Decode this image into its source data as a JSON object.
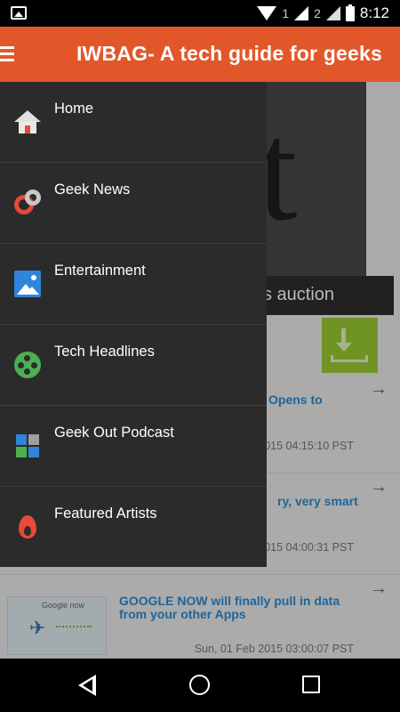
{
  "status_bar": {
    "time": "8:12",
    "sim1": "1",
    "sim2": "2",
    "icons": [
      "image-icon",
      "wifi-icon",
      "signal-icon",
      "signal-icon",
      "battery-icon"
    ]
  },
  "app_bar": {
    "title": "IWBAG- A tech guide for geeks",
    "menu_icon": "hamburger-icon",
    "color": "#e2572a"
  },
  "drawer": {
    "items": [
      {
        "label": "Home",
        "icon": "home-icon"
      },
      {
        "label": "Geek News",
        "icon": "geek-news-icon"
      },
      {
        "label": "Entertainment",
        "icon": "picture-icon"
      },
      {
        "label": "Tech Headlines",
        "icon": "film-reel-icon"
      },
      {
        "label": "Geek Out Podcast",
        "icon": "puzzle-icon"
      },
      {
        "label": "Featured Artists",
        "icon": "flame-icon"
      }
    ]
  },
  "content": {
    "hero_caption": "s auction",
    "articles": [
      {
        "title": "Opens to",
        "date": "2015 04:15:10 PST"
      },
      {
        "title": "ry, very smart",
        "date": "2015 04:00:31 PST"
      },
      {
        "title": "GOOGLE NOW will finally pull in data from your other Apps",
        "date": "Sun, 01 Feb 2015 03:00:07 PST",
        "thumb_text": "Google now"
      }
    ]
  },
  "nav_bar": {
    "icons": [
      "back-icon",
      "home-circle-icon",
      "recent-apps-icon"
    ]
  }
}
